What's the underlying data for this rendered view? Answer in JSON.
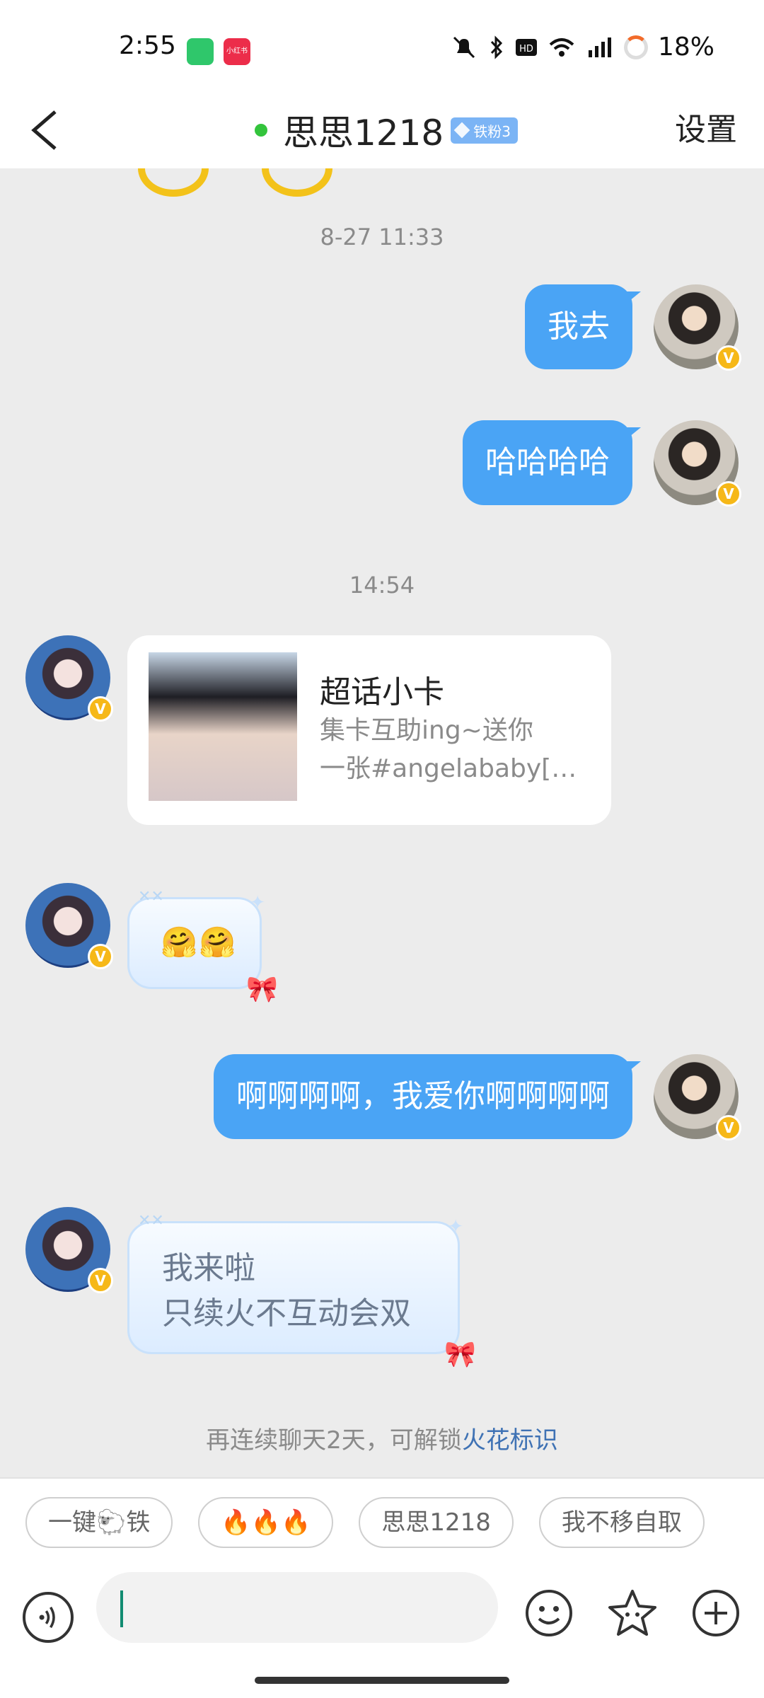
{
  "status_bar": {
    "time": "2:55",
    "app2_label": "小红书",
    "battery": "18%"
  },
  "header": {
    "title": "思思1218",
    "badge": "铁粉3",
    "settings": "设置"
  },
  "messages": {
    "ts1": "8-27 11:33",
    "me1": "我去",
    "me2": "哈哈哈哈",
    "ts2": "14:54",
    "card": {
      "title": "超话小卡",
      "desc1": "集卡互助ing~送你",
      "desc2": "一张#angelababy[超..."
    },
    "emoji_msg": "🤗🤗",
    "me3": "啊啊啊啊，我爱你啊啊啊啊",
    "other_line1": "我来啦",
    "other_line2": "只续火不互动会双"
  },
  "hint": {
    "text": "再连续聊天2天，可解锁",
    "link": "火花标识"
  },
  "quick_replies": [
    "一键🐑铁",
    "🔥🔥🔥",
    "思思1218",
    "我不移自取"
  ],
  "input": {
    "placeholder": ""
  },
  "colors": {
    "my_bubble": "#4aa4f5",
    "link": "#3f72b4",
    "online": "#33c43c",
    "verified": "#f6b818"
  }
}
